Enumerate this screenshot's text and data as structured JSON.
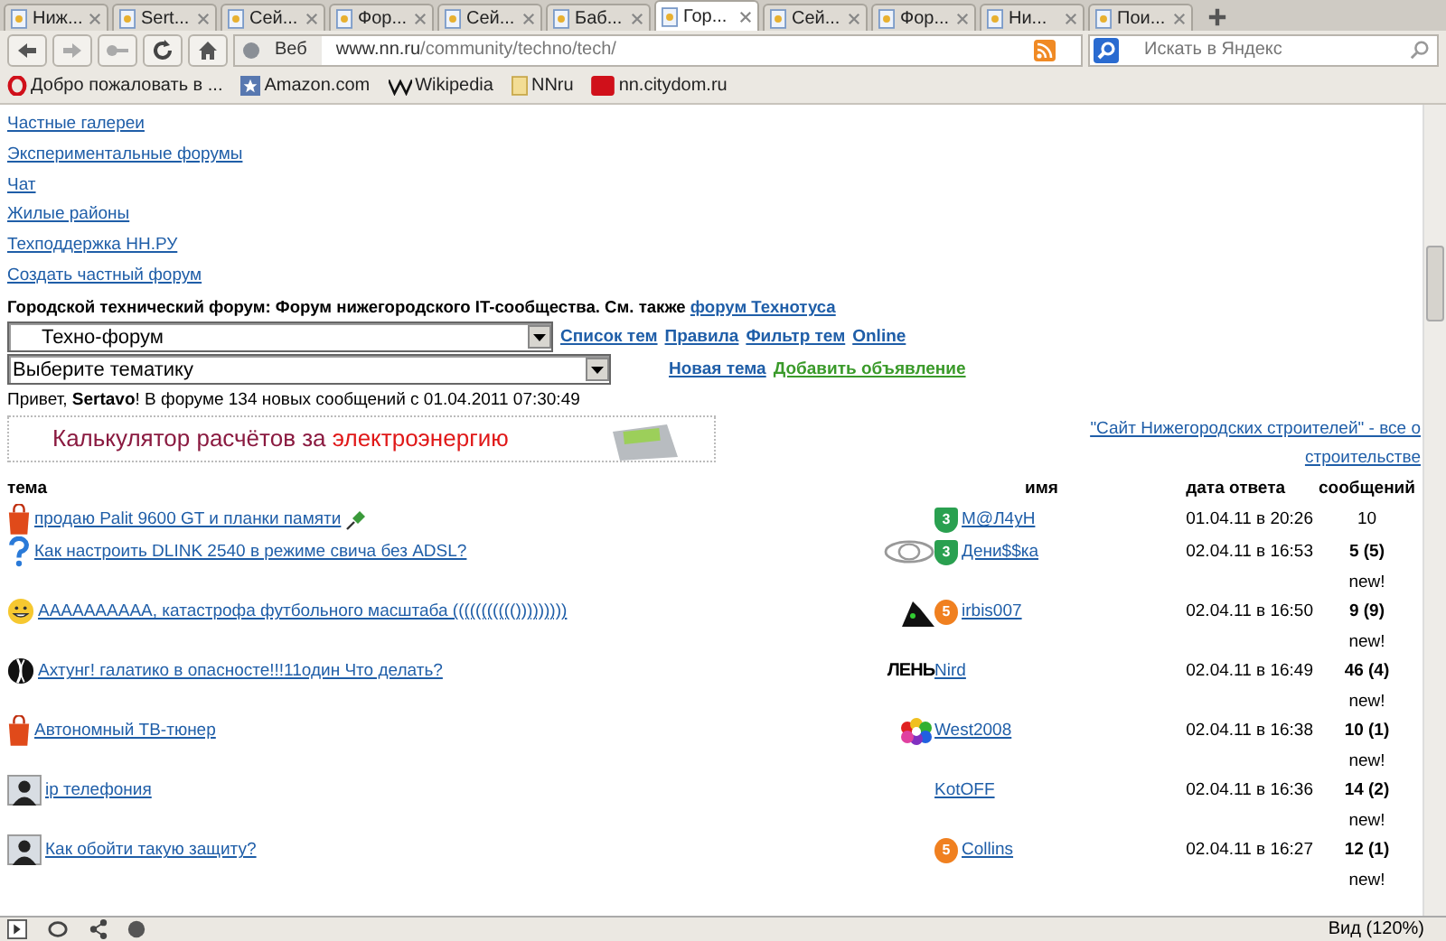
{
  "tabs": [
    {
      "label": "Ниж...",
      "selected": false
    },
    {
      "label": "Sert...",
      "selected": false
    },
    {
      "label": "Сей...",
      "selected": false
    },
    {
      "label": "Фор...",
      "selected": false
    },
    {
      "label": "Сей...",
      "selected": false
    },
    {
      "label": "Баб...",
      "selected": false
    },
    {
      "label": "Гор...",
      "selected": true
    },
    {
      "label": "Сей...",
      "selected": false
    },
    {
      "label": "Фор...",
      "selected": false
    },
    {
      "label": "Ни...",
      "selected": false
    },
    {
      "label": "Пои...",
      "selected": false
    }
  ],
  "address_bar": {
    "mode": "Веб",
    "url_host": "www.nn.ru",
    "url_path": "/community/techno/tech/"
  },
  "search": {
    "placeholder": "Искать в Яндекс"
  },
  "bookmarks": [
    {
      "label": "Добро пожаловать в ...",
      "kind": "opera"
    },
    {
      "label": "Amazon.com",
      "kind": "star"
    },
    {
      "label": "Wikipedia",
      "kind": "wiki"
    },
    {
      "label": "NNru",
      "kind": "folder"
    },
    {
      "label": "nn.citydom.ru",
      "kind": "red"
    }
  ],
  "links": [
    "Частные галереи",
    "Экспериментальные форумы",
    "Чат",
    "Жилые районы",
    "Техподдержка НН.РУ",
    "Создать частный форум"
  ],
  "forum_title": {
    "text": "Городской технический форум: Форум нижегородского IT-сообщества. См. также",
    "link": "форум Технотуса"
  },
  "forum_select": {
    "value": "Техно-форум"
  },
  "topic_select": {
    "value": "Выберите тематику"
  },
  "nav_links": [
    {
      "label": "Список тем",
      "kind": "nav"
    },
    {
      "label": "Правила",
      "kind": "nav"
    },
    {
      "label": "Фильтр тем",
      "kind": "nav"
    },
    {
      "label": "Online",
      "kind": "nav"
    }
  ],
  "action_links": [
    {
      "label": "Новая тема",
      "kind": "nav"
    },
    {
      "label": "Добавить объявление",
      "kind": "ad"
    }
  ],
  "greeting": "Привет, **Sertavo**! В форуме 134 новых сообщений с 01.04.2011 07:30:49",
  "banner": {
    "text": "Калькулятор расчётов за",
    "accent": "электроэнергию"
  },
  "side_link": [
    "\"Сайт Нижегородских строителей\" - все о",
    "строительстве"
  ],
  "table": {
    "columns": [
      "тема",
      "имя",
      "дата ответа",
      "сообщений"
    ],
    "rows": [
      {
        "kind": "sale",
        "title": "продаю Palit 9600 GT и планки памяти",
        "pinned": true,
        "badge": {
          "kind": "shield",
          "text": "3"
        },
        "user": "M@Л4уН",
        "date": "01.04.11 в 20:26",
        "count": "10",
        "new": false
      },
      {
        "kind": "question",
        "title": "Как настроить DLINK 2540 в режиме свича без ADSL?",
        "pinned": false,
        "badge": {
          "kind": "shield",
          "text": "3"
        },
        "user": "Дени$$ка",
        "date": "02.04.11 в 16:53",
        "count": "5 (5)",
        "new": true,
        "new_label": "new!"
      },
      {
        "kind": "fun",
        "title": "АААААААААА, катастрофа футбольного масштаба ((((((((((()))))))))",
        "pinned": false,
        "badge": {
          "kind": "medal",
          "text": "5"
        },
        "user": "irbis007",
        "date": "02.04.11 в 16:50",
        "count": "9 (9)",
        "new": true,
        "new_label": "new!"
      },
      {
        "kind": "sport",
        "title": "Ахтунг! галатико в опасносте!!!11один Что делать?",
        "pinned": false,
        "avatar_text": "ЛЕНЬ",
        "user": "Nird",
        "date": "02.04.11 в 16:49",
        "count": "46 (4)",
        "new": true,
        "new_label": "new!"
      },
      {
        "kind": "sale",
        "title": "Автономный ТВ-тюнер",
        "pinned": false,
        "user": "West2008",
        "date": "02.04.11 в 16:38",
        "count": "10 (1)",
        "new": true,
        "new_label": "new!"
      },
      {
        "kind": "discussion",
        "title": "ip телефония",
        "pinned": false,
        "user": "KotOFF",
        "date": "02.04.11 в 16:36",
        "count": "14 (2)",
        "new": true,
        "new_label": "new!"
      },
      {
        "kind": "discussion",
        "title": "Как обойти такую защиту?",
        "pinned": false,
        "badge": {
          "kind": "medal",
          "text": "5"
        },
        "user": "Collins",
        "date": "02.04.11 в 16:27",
        "count": "12 (1)",
        "new": true,
        "new_label": "new!"
      }
    ]
  },
  "status_bar": {
    "zoom": "Вид (120%)"
  }
}
